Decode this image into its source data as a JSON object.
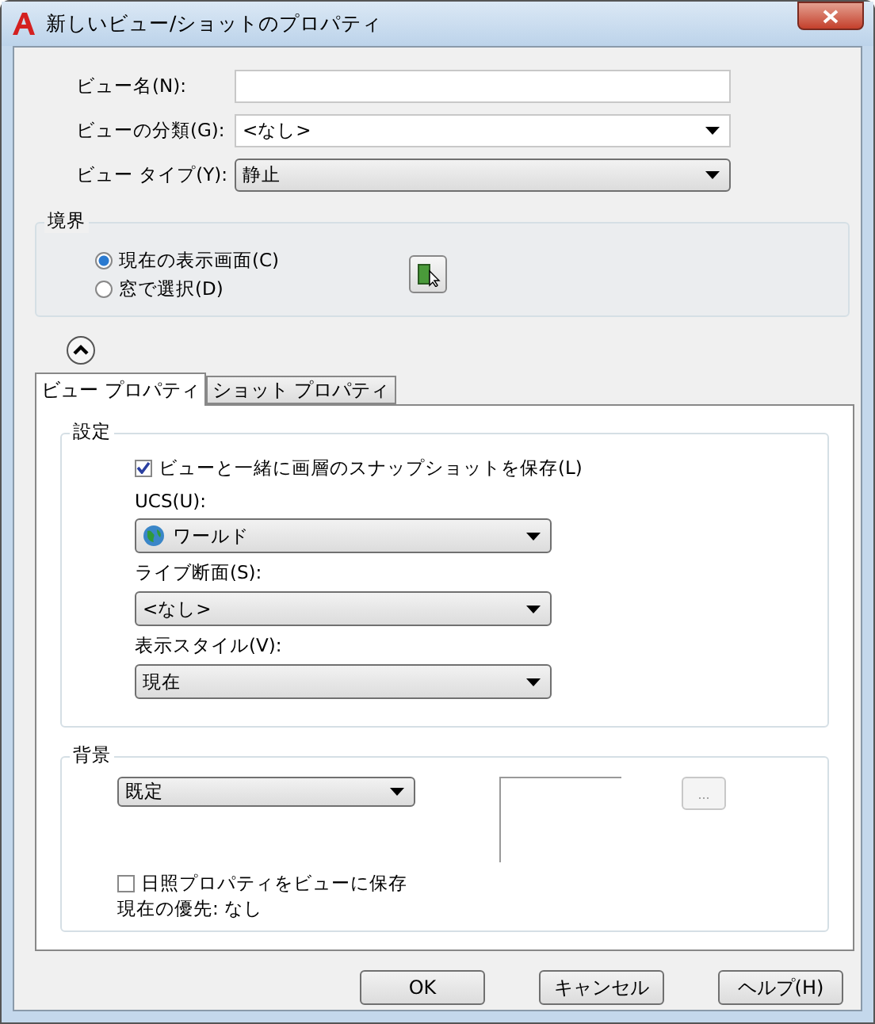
{
  "window": {
    "title": "新しいビュー/ショットのプロパティ"
  },
  "fields": [
    {
      "label": "ビュー名(N):",
      "kind": "text"
    },
    {
      "label": "ビューの分類(G):",
      "kind": "combo",
      "value": "<なし>"
    },
    {
      "label": "ビュー タイプ(Y):",
      "kind": "dropdown",
      "value": "静止"
    }
  ],
  "boundary": {
    "title": "境界",
    "options": [
      {
        "label": "現在の表示画面(C)",
        "selected": true
      },
      {
        "label": "窓で選択(D)",
        "selected": false
      }
    ]
  },
  "details": {
    "expanded": true
  },
  "tabs": [
    {
      "label": "ビュー プロパティ",
      "selected": true
    },
    {
      "label": "ショット プロパティ",
      "selected": false
    }
  ],
  "settings": {
    "title": "設定",
    "snapshot": {
      "label": "ビューと一緒に画層のスナップショットを保存(L)",
      "checked": true
    },
    "selects": [
      {
        "label": "UCS(U):",
        "value": "ワールド",
        "kind": "globe"
      },
      {
        "label": "ライブ断面(S):",
        "value": "<なし>",
        "kind": "plain"
      },
      {
        "label": "表示スタイル(V):",
        "value": "現在",
        "kind": "plain"
      }
    ]
  },
  "background": {
    "title": "背景",
    "value": "既定",
    "browse": "...",
    "sun": {
      "label": "日照プロパティをビューに保存",
      "checked": false
    },
    "override": "現在の優先: なし"
  },
  "buttons": [
    "OK",
    "キャンセル",
    "ヘルプ(H)"
  ]
}
